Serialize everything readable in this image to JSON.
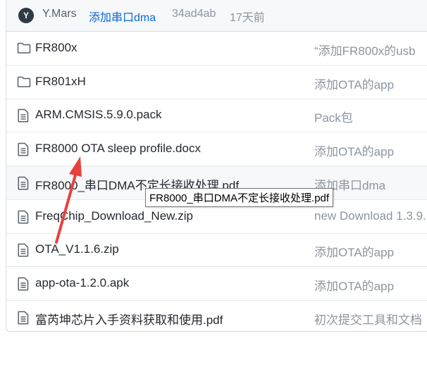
{
  "commit": {
    "avatar_initial": "Y",
    "author": "Y.Mars",
    "message": "添加串口dma",
    "sha": "34ad4ab",
    "age": "17天前"
  },
  "files": [
    {
      "type": "folder",
      "icon": "folder-icon",
      "name": "FR800x",
      "message": "“添加FR800x的usb"
    },
    {
      "type": "folder",
      "icon": "folder-icon",
      "name": "FR801xH",
      "message": "添加OTA的app"
    },
    {
      "type": "file",
      "icon": "file-icon",
      "name": "ARM.CMSIS.5.9.0.pack",
      "message": "Pack包"
    },
    {
      "type": "file",
      "icon": "file-icon",
      "name": "FR8000 OTA sleep profile.docx",
      "message": "添加OTA的app"
    },
    {
      "type": "file",
      "icon": "file-icon",
      "name": "FR8000_串口DMA不定长接收处理.pdf",
      "message": "添加串口dma"
    },
    {
      "type": "file",
      "icon": "file-icon",
      "name": "FreqChip_Download_New.zip",
      "message": "new Download 1.3.9."
    },
    {
      "type": "file",
      "icon": "file-icon",
      "name": "OTA_V1.1.6.zip",
      "message": "添加OTA的app"
    },
    {
      "type": "file",
      "icon": "file-icon",
      "name": "app-ota-1.2.0.apk",
      "message": "添加OTA的app"
    },
    {
      "type": "file",
      "icon": "file-icon",
      "name": "富芮坤芯片入手资料获取和使用.pdf",
      "message": "初次提交工具和文档"
    }
  ],
  "tooltip": "FR8000_串口DMA不定长接收处理.pdf",
  "colors": {
    "link": "#0969da",
    "muted": "#8c959f",
    "annotation": "#e8413c"
  }
}
